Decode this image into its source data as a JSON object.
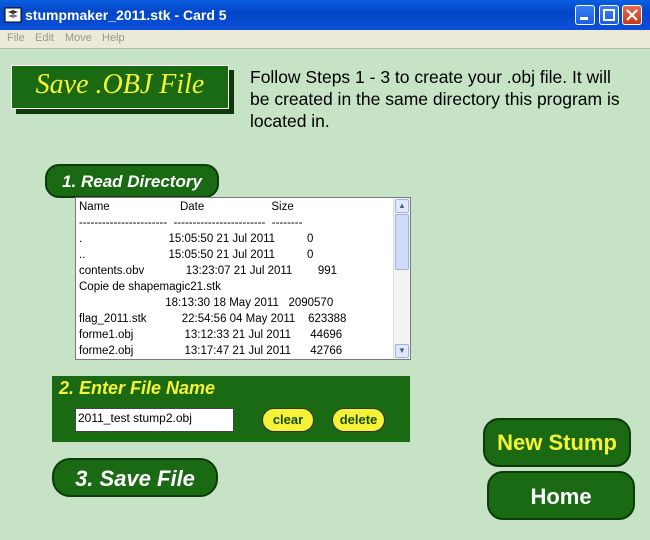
{
  "window": {
    "title": "stumpmaker_2011.stk - Card 5"
  },
  "menu": {
    "items": [
      "File",
      "Edit",
      "Move",
      "Help"
    ]
  },
  "header": {
    "title": "Save .OBJ File",
    "instructions": "Follow Steps 1 - 3 to create your .obj file. It will be created in the same directory this program is located in."
  },
  "step1": {
    "label": "1. Read Directory"
  },
  "directory_list": {
    "rows": [
      "Name                      Date                     Size",
      "-----------------------  ------------------------  --------",
      ".                           15:05:50 21 Jul 2011          0",
      "..                          15:05:50 21 Jul 2011          0",
      "contents.obv             13:23:07 21 Jul 2011        991",
      "Copie de shapemagic21.stk",
      "                           18:13:30 18 May 2011   2090570",
      "flag_2011.stk           22:54:56 04 May 2011    623388",
      "forme1.obj                13:12:33 21 Jul 2011      44696",
      "forme2.obj                13:17:47 21 Jul 2011      42766"
    ]
  },
  "step2": {
    "label": "2. Enter File Name",
    "file_name": "2011_test stump2.obj",
    "clear_label": "clear",
    "delete_label": "delete"
  },
  "step3": {
    "label": "3. Save File"
  },
  "buttons": {
    "new_stump": "New Stump",
    "home": "Home"
  }
}
